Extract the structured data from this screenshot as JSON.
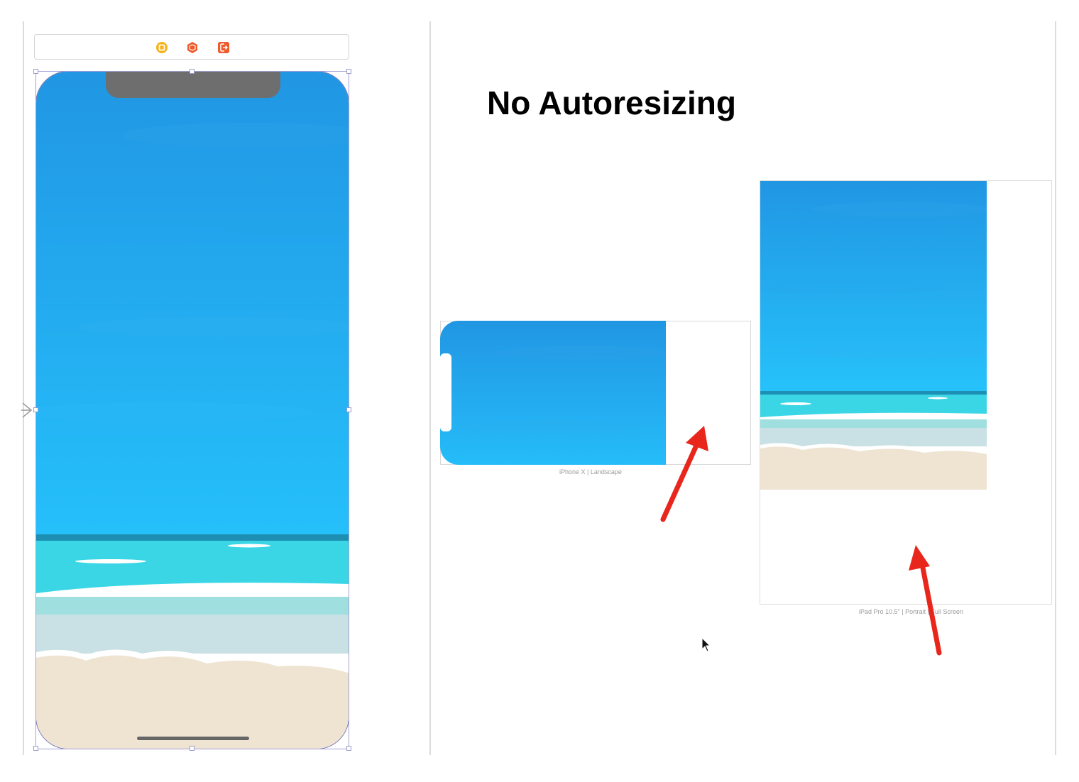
{
  "slide": {
    "title": "No Autoresizing"
  },
  "toolbar": {
    "icons": [
      "view-controller-icon",
      "first-responder-icon",
      "exit-icon"
    ]
  },
  "previews": {
    "landscape_caption": "iPhone X | Landscape",
    "ipad_caption": "iPad Pro 10.5\" | Portrait | Full Screen"
  },
  "colors": {
    "sky_top": "#2196e3",
    "sky_bottom": "#25c0fb",
    "horizon": "#1c8fb3",
    "sea": "#3ad6e6",
    "sea_light": "#9fdfe0",
    "foam": "#c9e0e4",
    "sand": "#efe4d2",
    "annotation_arrow": "#e8261c"
  }
}
